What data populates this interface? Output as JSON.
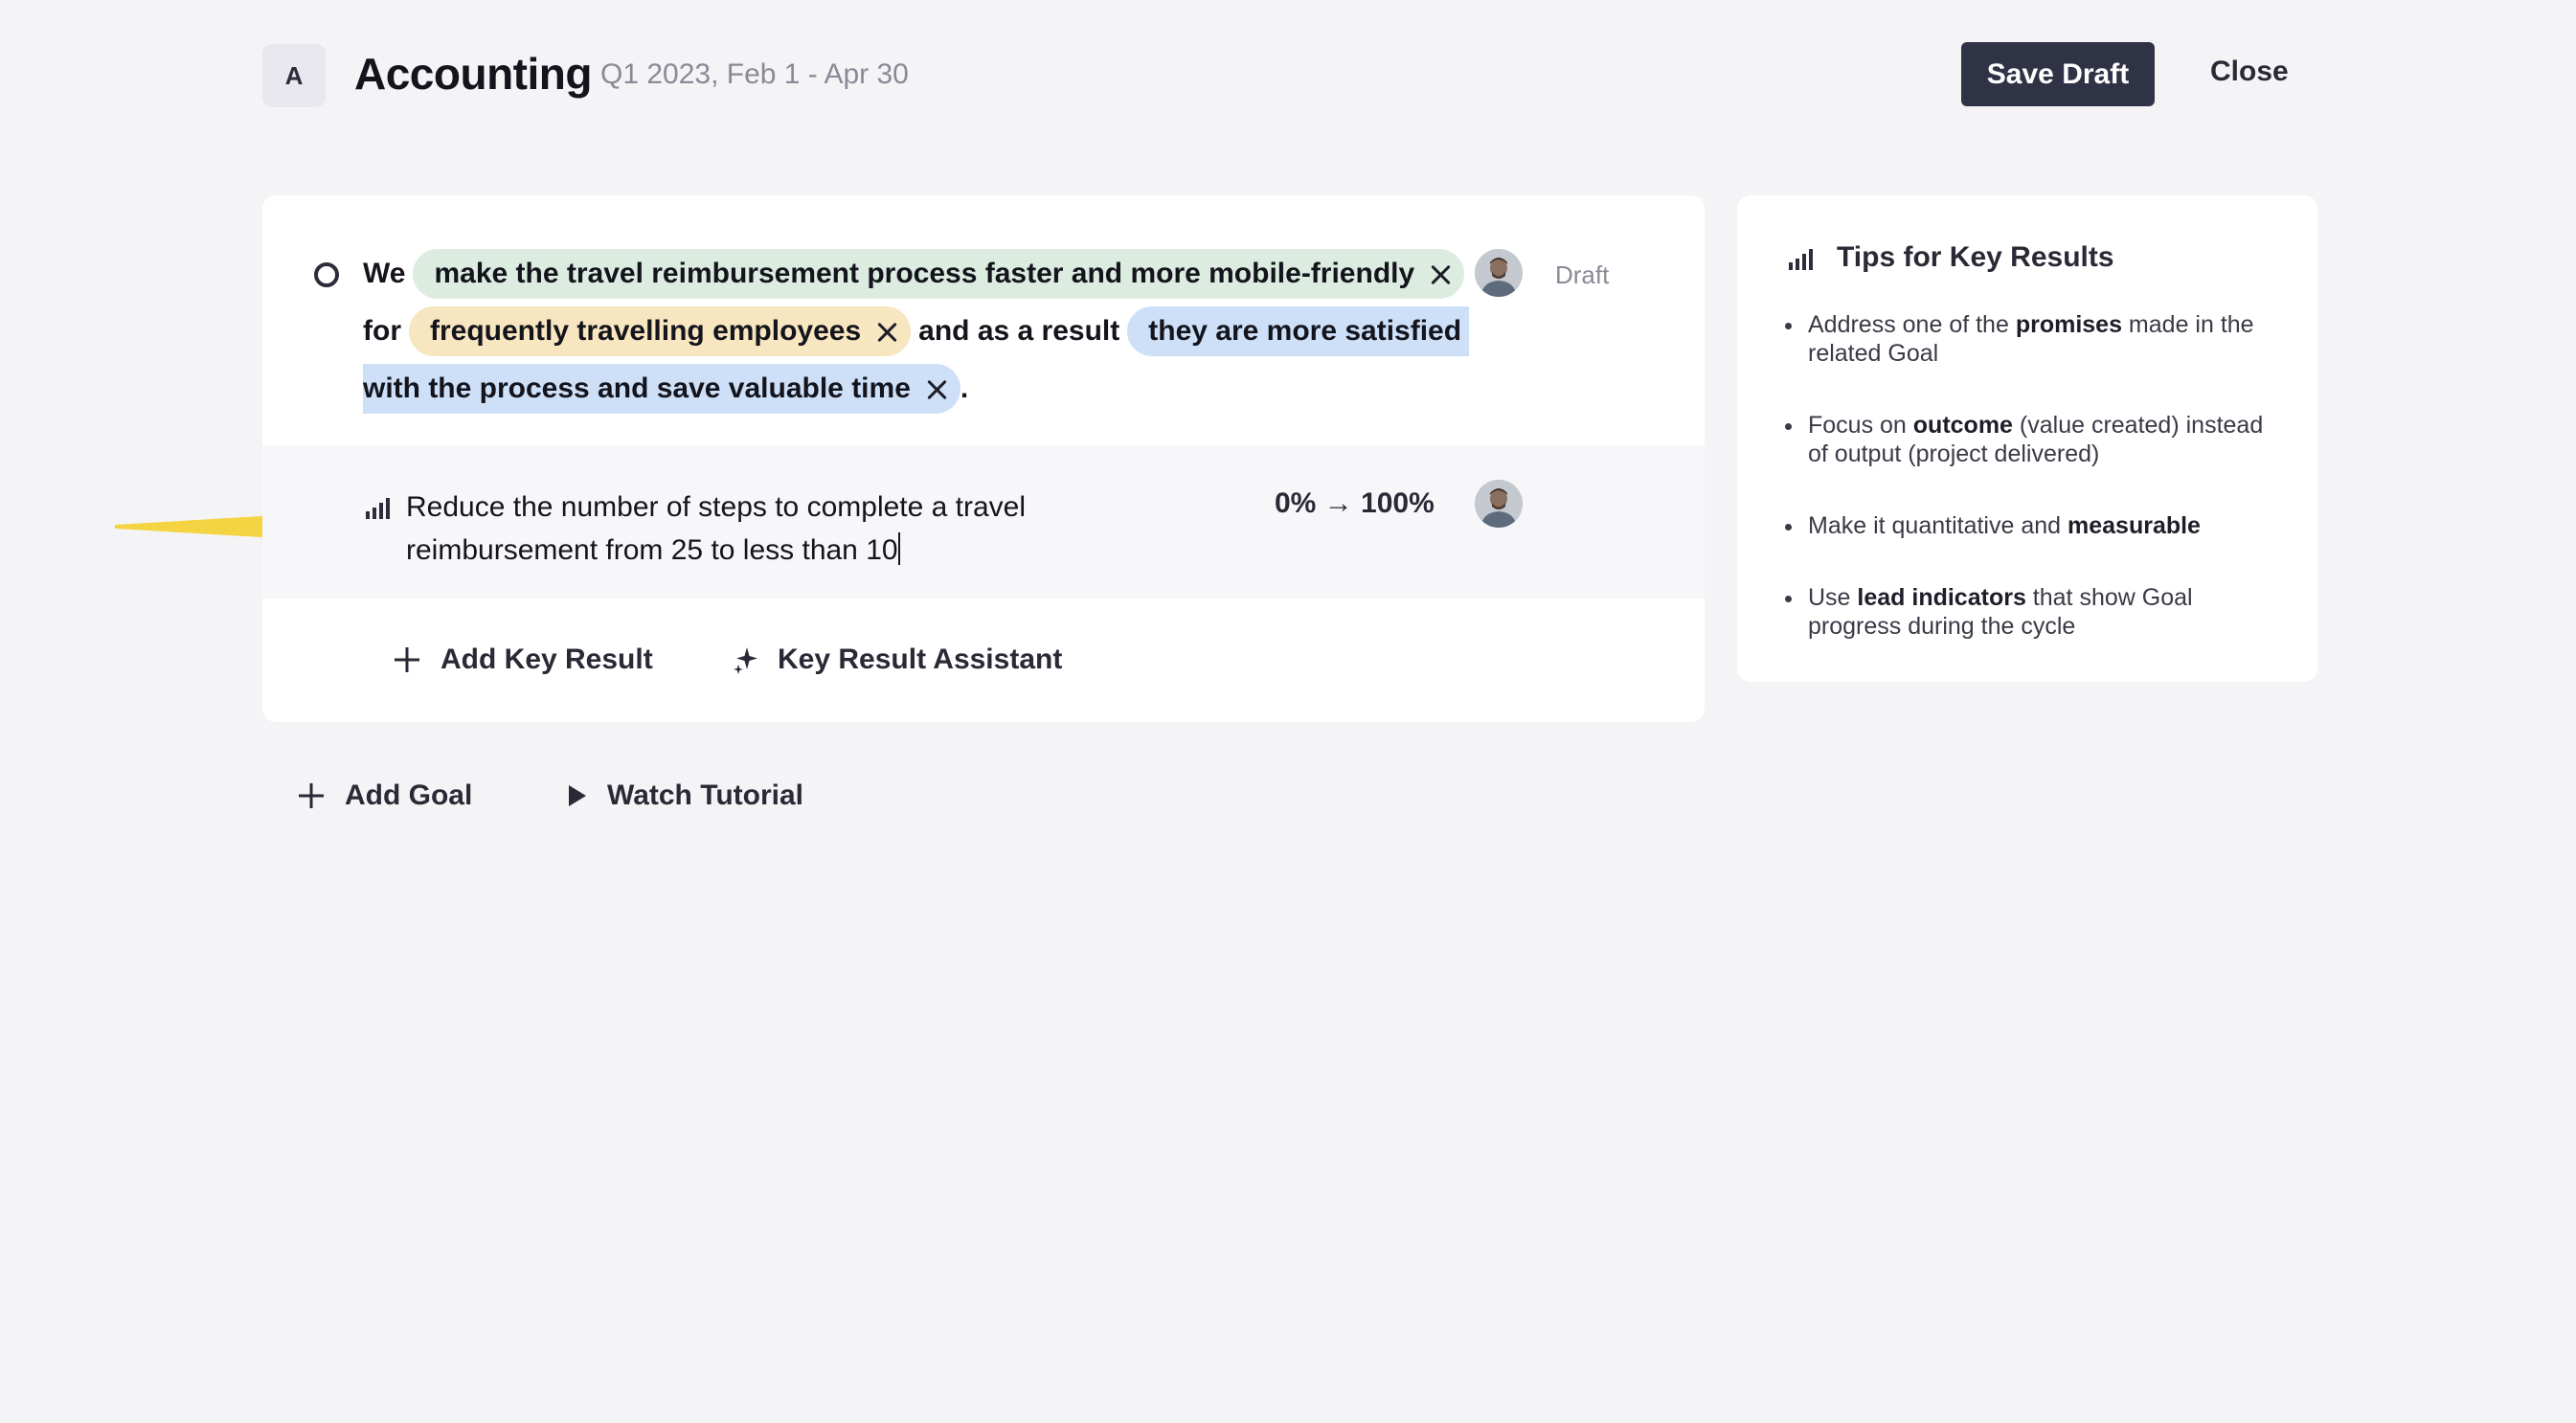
{
  "header": {
    "avatar_letter": "A",
    "title": "Accounting",
    "period": "Q1 2023, Feb 1 - Apr 30",
    "save_label": "Save Draft",
    "close_label": "Close"
  },
  "goal": {
    "status": "Draft",
    "we": "We",
    "promise": "make the travel reimbursement process faster and more mobile-friendly",
    "for": "for",
    "audience": "frequently travelling employees",
    "connector": "and as a result",
    "outcome_part1": "they are more satisfied",
    "outcome_part2": "with the process and save valuable time",
    "period_mark": "."
  },
  "key_result": {
    "text": "Reduce the number of steps to complete a travel reimbursement from 25 to less than 10",
    "progress": "0% → 100%",
    "icon": "bar-chart-icon"
  },
  "actions": {
    "add_key_result": "Add Key Result",
    "assistant": "Key Result Assistant",
    "add_goal": "Add Goal",
    "watch_tutorial": "Watch Tutorial"
  },
  "tips": {
    "title": "Tips for Key Results",
    "items": [
      {
        "pre": "Address one of the ",
        "bold": "promises",
        "post": " made in the related Goal"
      },
      {
        "pre": "Focus on ",
        "bold": "outcome",
        "post": " (value created) instead of output (project delivered)"
      },
      {
        "pre": "Make it quantitative and ",
        "bold": "measurable",
        "post": ""
      },
      {
        "pre": "Use ",
        "bold": "lead indicators",
        "post": " that show Goal progress during the cycle"
      }
    ]
  },
  "colors": {
    "background": "#f4f4f7",
    "primary_button": "#303246",
    "chip_green": "#dcece0",
    "chip_yellow": "#f7e6bf",
    "chip_blue": "#cde0f8",
    "arrow": "#f5d443"
  }
}
